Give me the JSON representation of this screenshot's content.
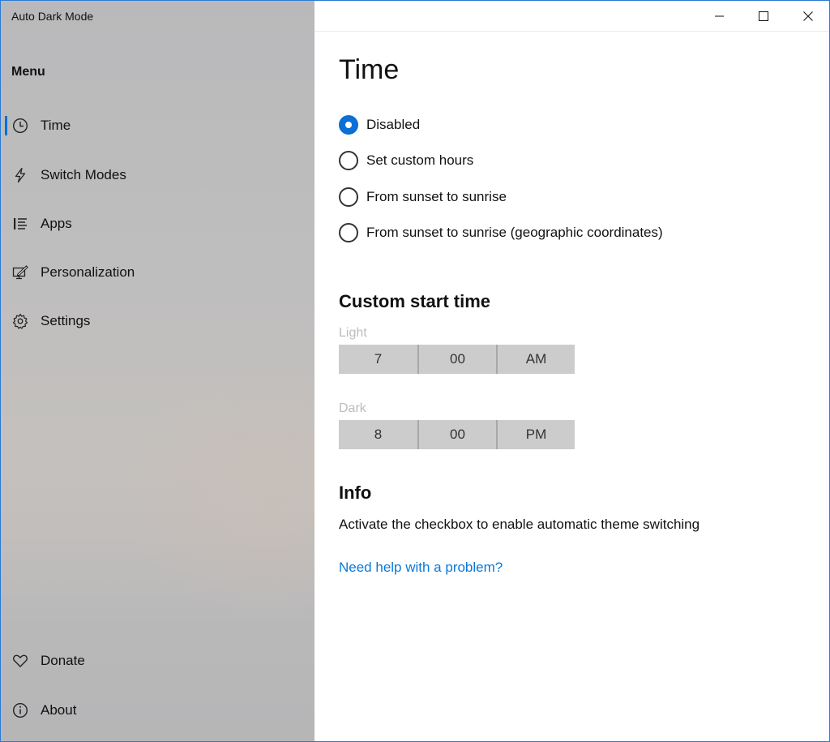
{
  "window": {
    "app_title": "Auto Dark Mode",
    "accent_color": "#0b6fd4"
  },
  "sidebar": {
    "menu_heading": "Menu",
    "items": [
      {
        "label": "Time",
        "icon": "clock-icon",
        "selected": true
      },
      {
        "label": "Switch Modes",
        "icon": "lightning-icon",
        "selected": false
      },
      {
        "label": "Apps",
        "icon": "list-icon",
        "selected": false
      },
      {
        "label": "Personalization",
        "icon": "monitor-pen-icon",
        "selected": false
      },
      {
        "label": "Settings",
        "icon": "gear-icon",
        "selected": false
      }
    ],
    "footer_items": [
      {
        "label": "Donate",
        "icon": "heart-icon"
      },
      {
        "label": "About",
        "icon": "info-icon"
      }
    ]
  },
  "main": {
    "title": "Time",
    "radio_options": [
      {
        "label": "Disabled",
        "checked": true
      },
      {
        "label": "Set custom hours",
        "checked": false
      },
      {
        "label": "From sunset to sunrise",
        "checked": false
      },
      {
        "label": "From sunset to sunrise (geographic coordinates)",
        "checked": false
      }
    ],
    "custom_start": {
      "title": "Custom start time",
      "light": {
        "label": "Light",
        "hour": "7",
        "minute": "00",
        "period": "AM"
      },
      "dark": {
        "label": "Dark",
        "hour": "8",
        "minute": "00",
        "period": "PM"
      }
    },
    "info": {
      "title": "Info",
      "text": "Activate the checkbox to enable automatic theme switching",
      "help_link": "Need help with a problem?"
    }
  }
}
